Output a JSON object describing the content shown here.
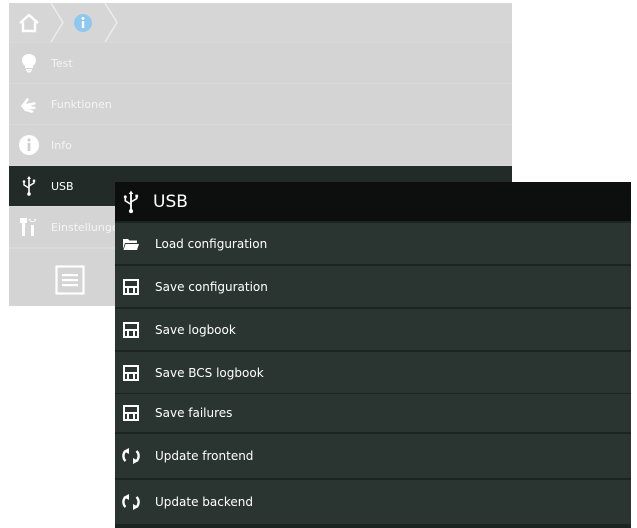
{
  "background_menu": {
    "items": [
      {
        "label": "Test",
        "icon": "lightbulb-icon"
      },
      {
        "label": "Funktionen",
        "icon": "hand-icon"
      },
      {
        "label": "Info",
        "icon": "info-icon"
      },
      {
        "label": "USB",
        "icon": "usb-icon"
      },
      {
        "label": "Einstellungen",
        "icon": "tools-icon"
      }
    ],
    "active_item": "USB"
  },
  "usb_dialog": {
    "title": "USB",
    "items": [
      {
        "label": "Load configuration",
        "icon": "folder-icon"
      },
      {
        "label": "Save configuration",
        "icon": "floppy-icon"
      },
      {
        "label": "Save logbook",
        "icon": "floppy-icon"
      },
      {
        "label": "Save BCS logbook",
        "icon": "floppy-icon"
      },
      {
        "label": "Save failures",
        "icon": "floppy-icon"
      },
      {
        "label": "Update frontend",
        "icon": "refresh-icon"
      },
      {
        "label": "Update backend",
        "icon": "refresh-icon"
      }
    ]
  },
  "colors": {
    "panel_bg": "#d4d4d4",
    "dialog_bg": "#2a3531",
    "header_bg": "#0d0f0e",
    "accent_blue": "#8fc8ee"
  }
}
